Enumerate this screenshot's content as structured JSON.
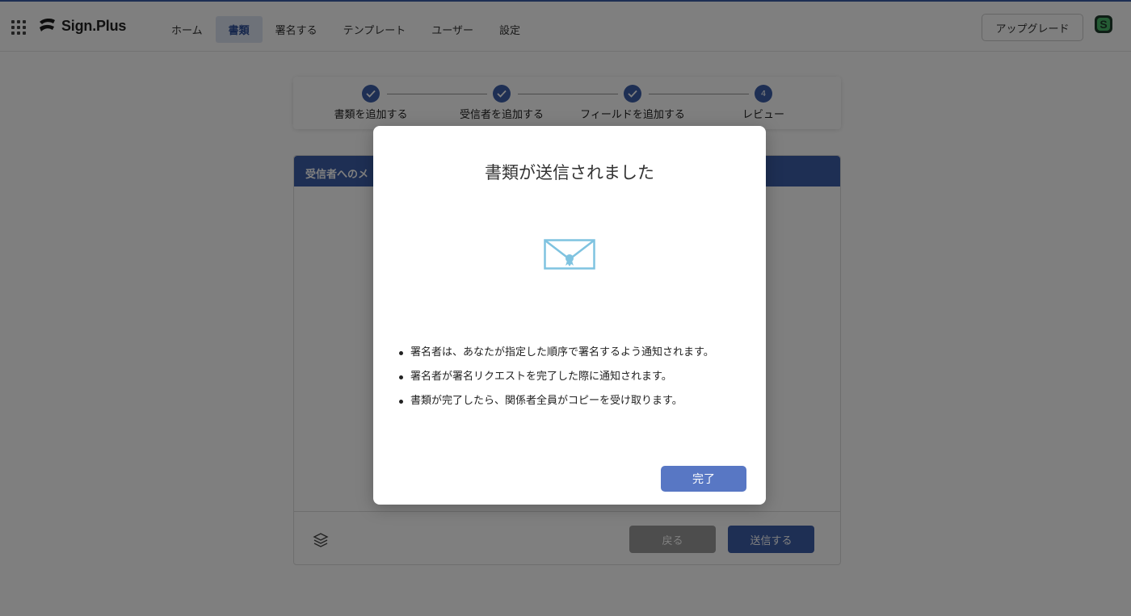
{
  "header": {
    "logo_text": "Sign.Plus",
    "nav": [
      {
        "label": "ホーム"
      },
      {
        "label": "書類",
        "active": true
      },
      {
        "label": "署名する"
      },
      {
        "label": "テンプレート"
      },
      {
        "label": "ユーザー"
      },
      {
        "label": "設定"
      }
    ],
    "upgrade_label": "アップグレード",
    "avatar_letter": "S"
  },
  "stepper": {
    "steps": [
      {
        "label": "書類を追加する",
        "state": "done"
      },
      {
        "label": "受信者を追加する",
        "state": "done"
      },
      {
        "label": "フィールドを追加する",
        "state": "done"
      },
      {
        "label": "レビュー",
        "state": "current",
        "number": "4"
      }
    ]
  },
  "panel": {
    "header": "受信者へのメ",
    "back_label": "戻る",
    "send_label": "送信する"
  },
  "modal": {
    "title": "書類が送信されました",
    "bullets": [
      "署名者は、あなたが指定した順序で署名するよう通知されます。",
      "署名者が署名リクエストを完了した際に通知されます。",
      "書類が完了したら、関係者全員がコピーを受け取ります。"
    ],
    "done_label": "完了"
  },
  "colors": {
    "primary": "#3d5ea8",
    "modal_button": "#5877c4",
    "envelope": "#7fc3e0",
    "overlay": "rgba(0,0,0,0.5)"
  }
}
